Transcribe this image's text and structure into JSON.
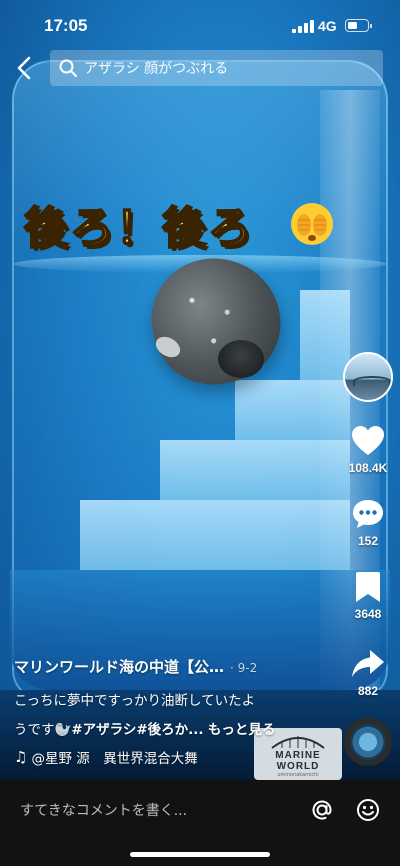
{
  "status_bar": {
    "time": "17:05",
    "network": "4G",
    "battery_level": 0.5
  },
  "search": {
    "query": "アザラシ 顔がつぶれる"
  },
  "video": {
    "overlay_caption": "後ろ！後ろ"
  },
  "actions": {
    "likes": "108.4K",
    "comments": "152",
    "saves": "3648",
    "shares": "882"
  },
  "post": {
    "author": "マリンワールド海の中道【公…",
    "date": "· 9-2",
    "description_line1": "こっちに夢中ですっかり油断していたよ",
    "description_line2_prefix": "うです",
    "hashtags": "#アザラシ#後ろか...",
    "more": "もっと見る",
    "music": "@星野 源　異世界混合大舞"
  },
  "logo": {
    "title": "MARINE WORLD",
    "subtitle": "uminonakamichi"
  },
  "comment_bar": {
    "placeholder": "すてきなコメントを書く..."
  },
  "icons": {
    "back": "back-arrow-icon",
    "search": "search-icon",
    "heart": "heart-icon",
    "comment": "comment-icon",
    "bookmark": "bookmark-icon",
    "share": "share-icon",
    "at": "at-icon",
    "emoji": "smile-icon"
  }
}
